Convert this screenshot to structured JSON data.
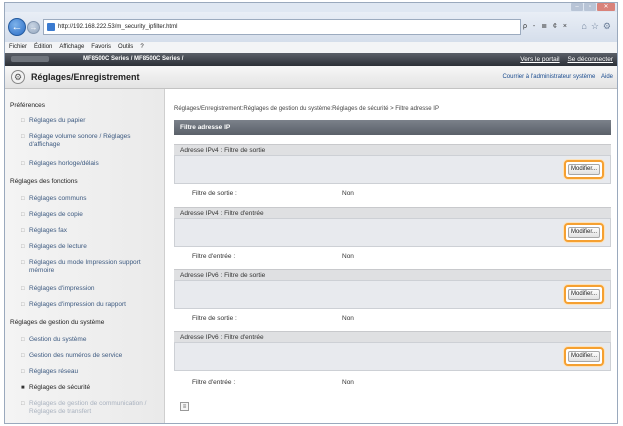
{
  "browser": {
    "url": "http://192.168.222.53/m_security_ipfilter.html",
    "search_label": "ρ - ≣ ¢ ×",
    "tab_icons": [
      "⌂",
      "☆",
      "⚙"
    ]
  },
  "menu": [
    "Fichier",
    "Édition",
    "Affichage",
    "Favoris",
    "Outils",
    "?"
  ],
  "series": {
    "model": "MF8500C Series / MF8500C Series /",
    "portal": "Vers le portail",
    "logout": "Se déconnecter"
  },
  "header": {
    "title": "Réglages/Enregistrement",
    "mail_admin": "Courrier à l'administrateur système",
    "help": "Aide"
  },
  "sidebar": {
    "preferences": "Préférences",
    "pref_items": [
      "Réglages du papier",
      "Réglage volume sonore / Réglages d'affichage",
      "Réglages horloge/délais"
    ],
    "functions": "Réglages des fonctions",
    "func_items": [
      "Réglages communs",
      "Réglages de copie",
      "Réglages fax",
      "Réglages de lecture",
      "Réglages du mode Impression support mémoire",
      "Réglages d'impression",
      "Réglages d'impression du rapport"
    ],
    "sysmgmt": "Réglages de gestion du système",
    "sys_items": [
      "Gestion du système",
      "Gestion des numéros de service",
      "Réglages réseau",
      "Réglages de sécurité",
      "Réglages de gestion de communication / Réglages de transfert"
    ]
  },
  "main": {
    "breadcrumb": "Réglages/Enregistrement:Réglages de gestion du système:Réglages de sécurité > Filtre adresse IP",
    "page_title": "Filtre adresse IP",
    "modify_label": "Modifier...",
    "status_value": "Non",
    "sections": [
      {
        "title": "Adresse IPv4 : Filtre de sortie",
        "row_label": "Filtre de sortie :"
      },
      {
        "title": "Adresse IPv4 : Filtre d'entrée",
        "row_label": "Filtre d'entrée :"
      },
      {
        "title": "Adresse IPv6 : Filtre de sortie",
        "row_label": "Filtre de sortie :"
      },
      {
        "title": "Adresse IPv6 : Filtre d'entrée",
        "row_label": "Filtre d'entrée :"
      }
    ]
  },
  "colors": {
    "highlight": "#f5a031",
    "section_header": "#5a6069"
  }
}
